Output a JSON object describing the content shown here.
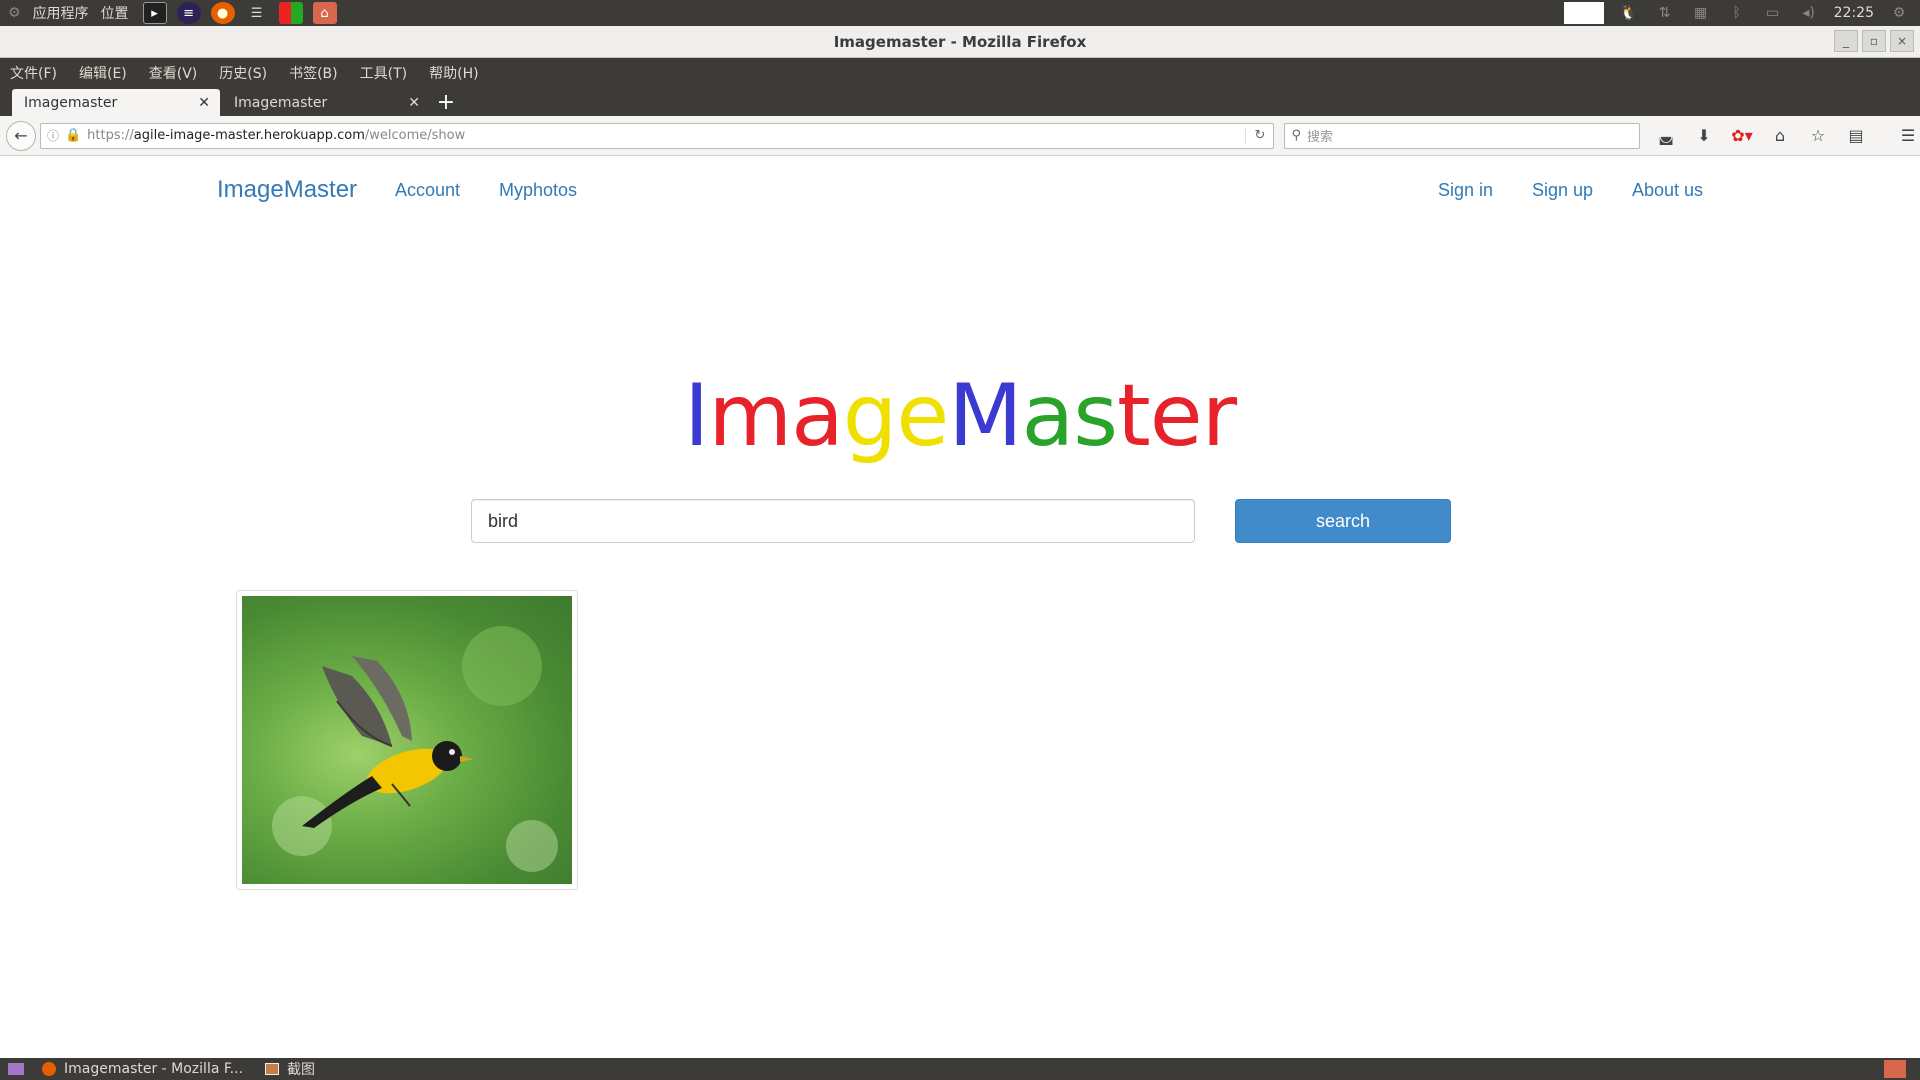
{
  "desktop": {
    "menu_apps": "应用程序",
    "menu_places": "位置",
    "clock": "22:25",
    "launchers": [
      "terminal-icon",
      "eclipse-icon",
      "firefox-icon",
      "server-icon",
      "palette-icon",
      "files-icon"
    ]
  },
  "window": {
    "title": "Imagemaster - Mozilla Firefox",
    "minimize": "_",
    "maximize": "▫",
    "close": "×"
  },
  "menubar": [
    "文件(F)",
    "编辑(E)",
    "查看(V)",
    "历史(S)",
    "书签(B)",
    "工具(T)",
    "帮助(H)"
  ],
  "tabs": [
    {
      "label": "Imagemaster",
      "active": true
    },
    {
      "label": "Imagemaster",
      "active": false
    }
  ],
  "urlbar": {
    "protocol": "https://",
    "host": "agile-image-master.herokuapp.com",
    "path": "/welcome/show"
  },
  "searchbar": {
    "placeholder": "搜索"
  },
  "site": {
    "brand": "ImageMaster",
    "nav_left": [
      "Account",
      "Myphotos"
    ],
    "nav_right": [
      "Sign in",
      "Sign up",
      "About us"
    ],
    "logo": [
      {
        "ch": "I",
        "color": "#3b3bd1"
      },
      {
        "ch": "m",
        "color": "#e8222a"
      },
      {
        "ch": "a",
        "color": "#e8222a"
      },
      {
        "ch": "g",
        "color": "#f0e000"
      },
      {
        "ch": "e",
        "color": "#f0e000"
      },
      {
        "ch": "M",
        "color": "#3b3bd1"
      },
      {
        "ch": "a",
        "color": "#2aa32a"
      },
      {
        "ch": "s",
        "color": "#2aa32a"
      },
      {
        "ch": "t",
        "color": "#e8222a"
      },
      {
        "ch": "e",
        "color": "#e8222a"
      },
      {
        "ch": "r",
        "color": "#e8222a"
      }
    ],
    "search_value": "bird",
    "search_button": "search",
    "results": [
      {
        "subject": "bird"
      }
    ]
  },
  "taskbar": {
    "items": [
      "Imagemaster - Mozilla F...",
      "截图"
    ]
  }
}
